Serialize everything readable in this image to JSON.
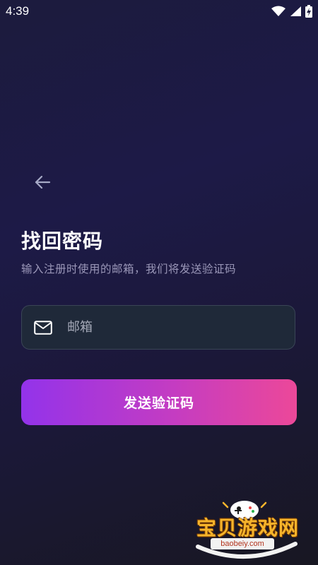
{
  "status_bar": {
    "time": "4:39",
    "icons": [
      "wifi-icon",
      "cellular-signal-icon",
      "battery-charging-icon"
    ]
  },
  "header": {
    "back_icon": "arrow-left-icon"
  },
  "title": "找回密码",
  "subtitle": "输入注册时使用的邮箱，我们将发送验证码",
  "email_field": {
    "icon": "mail-icon",
    "placeholder": "邮箱",
    "value": ""
  },
  "send_button": {
    "label": "发送验证码"
  },
  "watermark": {
    "text": "宝贝游戏网",
    "url": "baobeiy.com"
  },
  "colors": {
    "background": "#1c1b3d",
    "accent_start": "#9333ea",
    "accent_end": "#ec4899",
    "field_background": "#1f2939",
    "subtitle_text": "#9a97b8"
  }
}
